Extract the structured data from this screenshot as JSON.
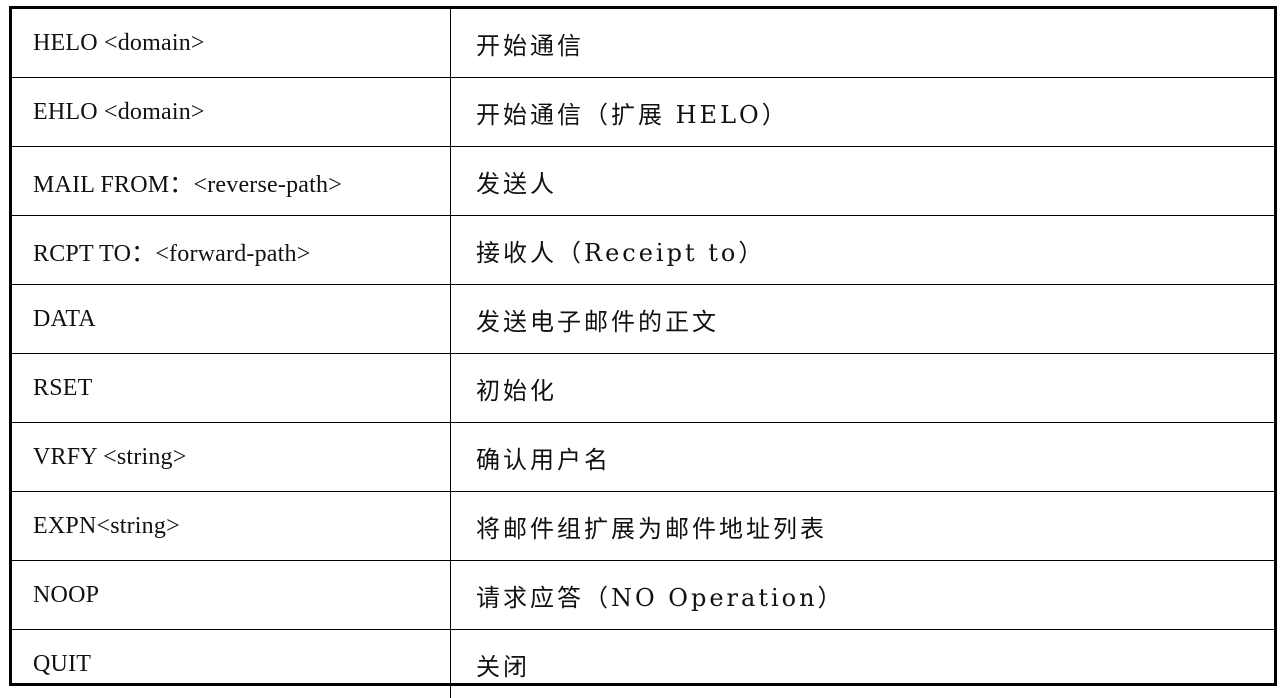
{
  "table": {
    "rows": [
      {
        "command": "HELO <domain>",
        "description": "开始通信"
      },
      {
        "command": "EHLO <domain>",
        "description": "开始通信（扩展 HELO）"
      },
      {
        "command": "MAIL FROM：<reverse-path>",
        "description": "发送人"
      },
      {
        "command": "RCPT TO：<forward-path>",
        "description": "接收人（Receipt to）"
      },
      {
        "command": "DATA",
        "description": "发送电子邮件的正文"
      },
      {
        "command": "RSET",
        "description": "初始化"
      },
      {
        "command": "VRFY <string>",
        "description": "确认用户名"
      },
      {
        "command": "EXPN<string>",
        "description": "将邮件组扩展为邮件地址列表"
      },
      {
        "command": "NOOP",
        "description": "请求应答（NO Operation）"
      },
      {
        "command": "QUIT",
        "description": "关闭"
      }
    ]
  }
}
